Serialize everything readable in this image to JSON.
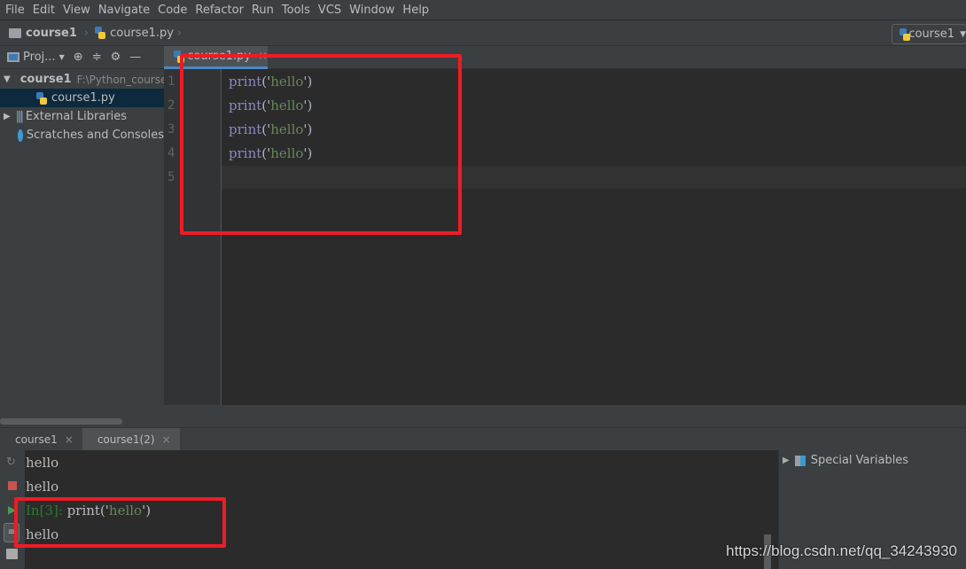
{
  "menu": [
    "File",
    "Edit",
    "View",
    "Navigate",
    "Code",
    "Refactor",
    "Run",
    "Tools",
    "VCS",
    "Window",
    "Help"
  ],
  "breadcrumb": {
    "project": "course1",
    "file": "course1.py"
  },
  "run_config": "course1",
  "project_panel": {
    "title": "Proj...",
    "tree": [
      {
        "label": "course1",
        "path": "F:\\Python_course"
      },
      {
        "label": "course1.py"
      },
      {
        "label": "External Libraries"
      },
      {
        "label": "Scratches and Consoles"
      }
    ]
  },
  "editor": {
    "tab": "course1.py",
    "lines": [
      {
        "num": "1",
        "fn": "print",
        "open": "('",
        "str": "hello",
        "close": "')"
      },
      {
        "num": "2",
        "fn": "print",
        "open": "('",
        "str": "hello",
        "close": "')"
      },
      {
        "num": "3",
        "fn": "print",
        "open": "('",
        "str": "hello",
        "close": "')"
      },
      {
        "num": "4",
        "fn": "print",
        "open": "('",
        "str": "hello",
        "close": "')"
      },
      {
        "num": "5"
      }
    ]
  },
  "console": {
    "tabs": [
      "course1",
      "course1(2)"
    ],
    "lines": [
      "hello",
      "hello"
    ],
    "prompt": "In[3]:",
    "input_fn": "print",
    "input_open": "('",
    "input_str": "hello",
    "input_close": "')",
    "output": "hello"
  },
  "variables": {
    "label": "Special Variables"
  },
  "watermark": "https://blog.csdn.net/qq_34243930",
  "colors": {
    "highlight": "#ee1c25",
    "accent": "#4a88c7"
  }
}
